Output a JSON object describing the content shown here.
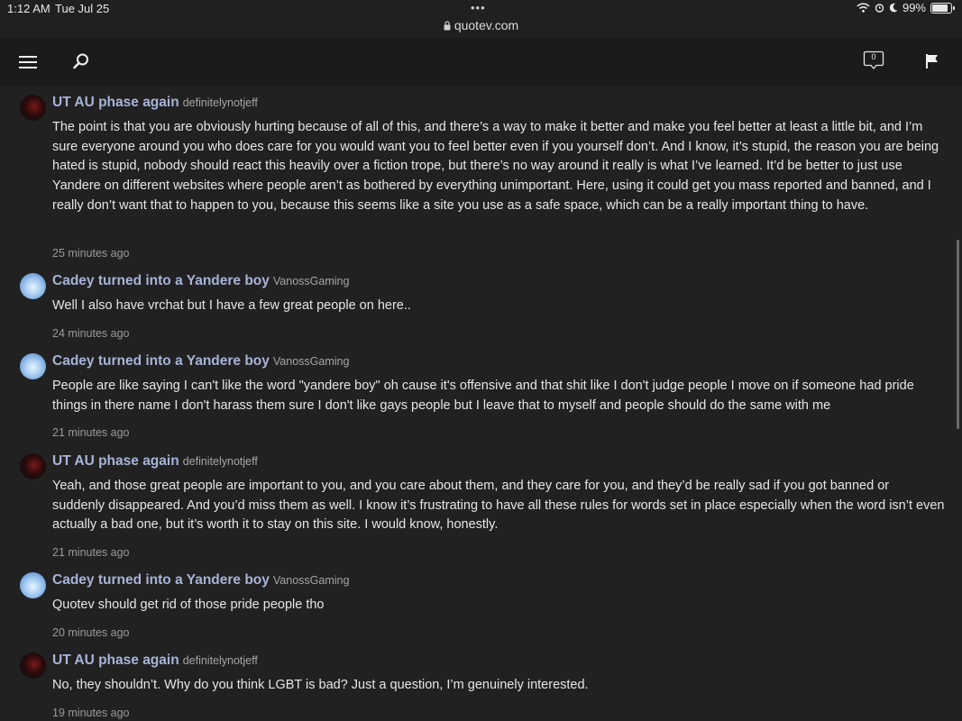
{
  "status": {
    "time": "1:12 AM",
    "date": "Tue Jul 25",
    "dots": "•••",
    "url": "quotev.com",
    "battery": "99%",
    "battery_level": 0.99
  },
  "nav": {
    "menu_icon": "hamburger-menu-icon",
    "search_icon": "search-icon",
    "notifications_count": "0",
    "flag_icon": "flag-icon"
  },
  "comments": [
    {
      "author": "UT AU phase again",
      "username": "definitelynotjeff",
      "text": "The point is that you are obviously hurting because of all of this, and there’s a way to make it better and make you feel better at least a little bit, and I’m sure everyone around you who does care for you would want you to feel better even if you yourself don’t. And I know, it’s stupid, the reason you are being hated is stupid, nobody should react this heavily over a fiction trope, but there’s no way around it really is what I’ve learned. It’d be better to just use Yandere on different websites where people aren’t as bothered by everything unimportant. Here, using it could get you mass reported and banned, and I really don’t want that to happen to you, because this seems like a site you use as a safe space, which can be a really important thing to have.",
      "time": "25 minutes ago"
    },
    {
      "author": "Cadey turned into a Yandere boy",
      "username": "VanossGaming",
      "text": "Well I also have vrchat but I have a few great people on here..",
      "time": "24 minutes ago"
    },
    {
      "author": "Cadey turned into a Yandere boy",
      "username": "VanossGaming",
      "text": "People are like saying I can't like the word \"yandere boy\" oh cause it's offensive and that shit like I don't judge people I move on if someone had pride things in there name I don't harass them sure I don't like gays people but I leave that to myself and people should do the same with me",
      "time": "21 minutes ago"
    },
    {
      "author": "UT AU phase again",
      "username": "definitelynotjeff",
      "text": "Yeah, and those great people are important to you, and you care about them, and they care for you, and they’d be really sad if you got banned or suddenly disappeared. And you’d miss them as well. I know it’s frustrating to have all these rules for words set in place especially when the word isn’t even actually a bad one, but it’s worth it to stay on this site. I would know, honestly.",
      "time": "21 minutes ago"
    },
    {
      "author": "Cadey turned into a Yandere boy",
      "username": "VanossGaming",
      "text": "Quotev should get rid of those pride people tho",
      "time": "20 minutes ago"
    },
    {
      "author": "UT AU phase again",
      "username": "definitelynotjeff",
      "text": "No, they shouldn’t. Why do you think LGBT is bad? Just a question, I’m genuinely interested.",
      "time": "19 minutes ago"
    }
  ]
}
